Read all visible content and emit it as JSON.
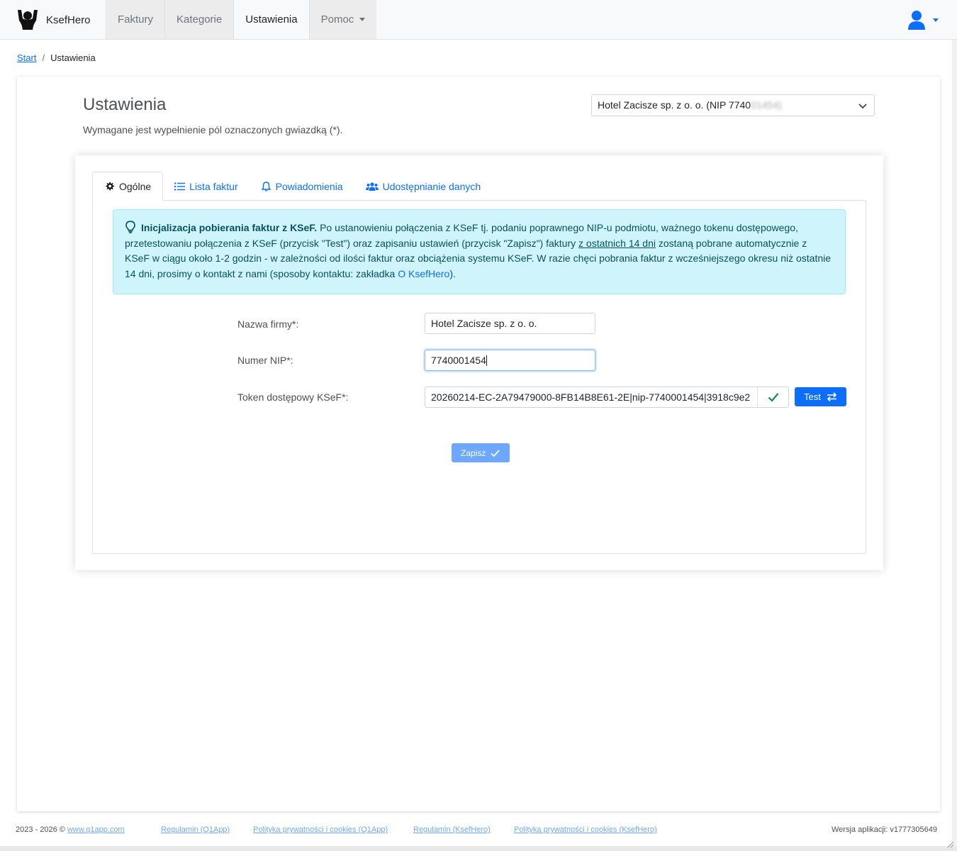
{
  "navbar": {
    "brand": "KsefHero",
    "items": [
      {
        "label": "Faktury"
      },
      {
        "label": "Kategorie"
      },
      {
        "label": "Ustawienia",
        "active": true
      },
      {
        "label": "Pomoc",
        "dropdown": true
      }
    ],
    "user_icon": "user-icon"
  },
  "breadcrumb": {
    "home": "Start",
    "separator": "/",
    "current": "Ustawienia"
  },
  "page": {
    "title": "Ustawienia",
    "required_note": "Wymagane jest wypełnienie pól oznaczonych gwiazdką (*).",
    "company_select": {
      "value_visible": "Hotel Zacisze sp. z o. o. (NIP 7740",
      "value_blurred": "01454)"
    }
  },
  "tabs": [
    {
      "label": "Ogólne",
      "icon": "gear-icon",
      "active": true
    },
    {
      "label": "Lista faktur",
      "icon": "list-icon"
    },
    {
      "label": "Powiadomienia",
      "icon": "bell-icon"
    },
    {
      "label": "Udostępnianie danych",
      "icon": "users-icon"
    }
  ],
  "alert": {
    "icon": "lightbulb-icon",
    "bold": "Inicjalizacja pobierania faktur z KSeF.",
    "text1": " Po ustanowieniu połączenia z KSeF tj. podaniu poprawnego NIP-u podmiotu, ważnego tokenu dostępowego, przetestowaniu połączenia z KSeF (przycisk \"Test\") oraz zapisaniu ustawień (przycisk \"Zapisz\") faktury ",
    "underlined": "z ostatnich 14 dni",
    "text2": " zostaną pobrane automatycznie z KSeF w ciągu około 1-2 godzin - w zależności od ilości faktur oraz obciążenia systemu KSeF. W razie chęci pobrania faktur z wcześniejszego okresu niż ostatnie 14 dni, prosimy o kontakt z nami (sposoby kontaktu: zakładka ",
    "link": "O KsefHero",
    "text3": ")."
  },
  "form": {
    "company_name": {
      "label": "Nazwa firmy*:",
      "value": "Hotel Zacisze sp. z o. o."
    },
    "nip": {
      "label": "Numer NIP*:",
      "value": "7740001454"
    },
    "token": {
      "label": "Token dostępowy KSeF*:",
      "value": "20260214-EC-2A79479000-8FB14B8E61-2E|nip-7740001454|3918c9e2",
      "status_icon": "check-icon"
    },
    "test_button": "Test",
    "save_button": "Zapisz"
  },
  "footer": {
    "copyright": "2023 - 2026 ©",
    "site_link": "www.q1app.com",
    "links": [
      "Regulamin (Q1App)",
      "Polityka prywatności i cookies (Q1App)",
      "Regulamin (KsefHero)",
      "Polityka prywatności i cookies (KsefHero)"
    ],
    "version": "Wersja aplikacji: v1777305649"
  },
  "colors": {
    "primary": "#0d6efd",
    "primary_disabled": "#6ea8fe",
    "alert_bg": "#cff4fc",
    "alert_text": "#055160",
    "success": "#198754"
  }
}
